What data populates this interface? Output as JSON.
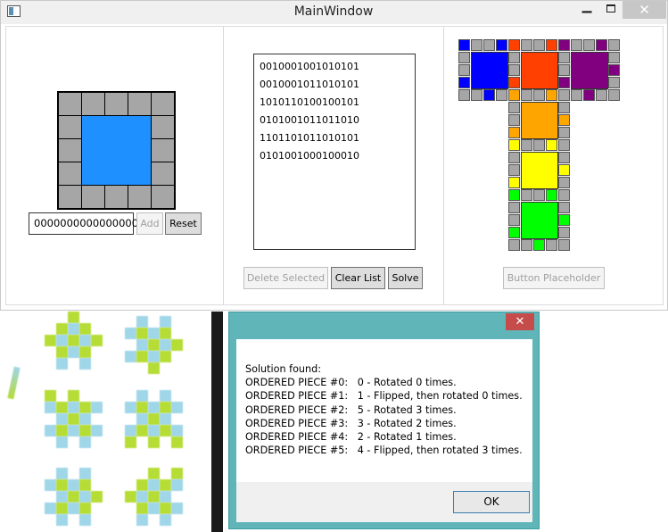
{
  "window": {
    "title": "MainWindow",
    "minimize": "▁",
    "close": "✕"
  },
  "editor": {
    "input_value": "0000000000000000",
    "add_label": "Add",
    "reset_label": "Reset",
    "center_color": "#1e90ff",
    "edge_color": "#a6a6a6"
  },
  "list": {
    "items": [
      "0010001001010101",
      "0010001011010101",
      "1010110100100101",
      "0101001011011010",
      "1101101011010101",
      "0101001000100010"
    ],
    "delete_label": "Delete Selected",
    "clear_label": "Clear List",
    "solve_label": "Solve"
  },
  "solution_panel": {
    "placeholder_label": "Button Placeholder",
    "piece_colors": [
      "#0000ff",
      "#ff4000",
      "#800080",
      "#ffa500",
      "#ffff00",
      "#00ff00"
    ]
  },
  "dialog": {
    "close": "✕",
    "lines": [
      "Solution found:",
      "ORDERED PIECE #0:   0 - Rotated 0 times.",
      "ORDERED PIECE #1:   1 - Flipped, then rotated 0 times.",
      "ORDERED PIECE #2:   5 - Rotated 3 times.",
      "ORDERED PIECE #3:   3 - Rotated 2 times.",
      "ORDERED PIECE #4:   2 - Rotated 1 times.",
      "ORDERED PIECE #5:   4 - Flipped, then rotated 3 times."
    ],
    "ok_label": "OK"
  }
}
